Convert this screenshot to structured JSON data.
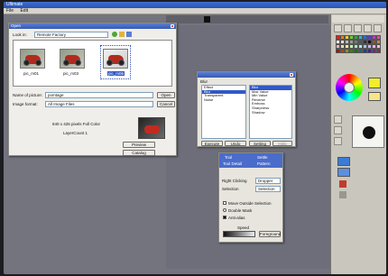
{
  "app": {
    "title": "Ultimate",
    "menu": [
      "File",
      "Edit"
    ]
  },
  "open_dialog": {
    "title": "Open",
    "look_in_label": "Look in:",
    "look_in_value": "Remote Factory",
    "thumbs": [
      {
        "label": "pic_m01"
      },
      {
        "label": "pic_m03"
      },
      {
        "label": "pic_m06",
        "selected": true
      }
    ],
    "name_label": "Name of picture:",
    "name_value": "pomtage",
    "type_label": "Image format:",
    "type_value": "All Image Files",
    "open_label": "Open",
    "cancel_label": "Cancel",
    "info_line": "640 x 426 pixels Full Color",
    "layer_line": "LayerCount 1",
    "preview_label": "Preview",
    "catalog_label": "Catalog"
  },
  "blur_dialog": {
    "title": "Blur",
    "left_items": [
      "Effect",
      "Blur",
      "Transparent",
      "Noise"
    ],
    "left_selected": 1,
    "right_items": [
      "Blur",
      "Max Value",
      "Min Value",
      "Reverse",
      "Emboss",
      "Sharpness",
      "Shadow"
    ],
    "right_selected": 0,
    "buttons": [
      "Execute",
      "Undo",
      "Setting",
      "Help"
    ]
  },
  "selection_panel": {
    "tabs": [
      "Tool",
      "Settle"
    ],
    "tabs2": [
      "Tool Detail",
      "Pattern"
    ],
    "right_clicking_label": "Right Clicking",
    "right_clicking_value": "Dropper",
    "selection_label": "Selection",
    "selection_value": "Selection",
    "options": [
      {
        "label": "Move Outside Selection",
        "checked": false
      },
      {
        "label": "Double Mask",
        "checked": false
      },
      {
        "label": "Anti-alias",
        "checked": true
      }
    ],
    "speed_label": "Speed",
    "apply_label": "Foreground"
  },
  "colors": {
    "palette": [
      "#e02020",
      "#f07a20",
      "#f4d21e",
      "#78c83c",
      "#2ea84a",
      "#2fb7c9",
      "#2d6de0",
      "#5b3cc4",
      "#b83cc4",
      "#e44a9a",
      "#ffffff",
      "#dddddd",
      "#bbbbbb",
      "#999999",
      "#777777",
      "#555555",
      "#333333",
      "#111111",
      "#8b5a2b",
      "#c08a4a",
      "#ffb0b0",
      "#ffd8a0",
      "#fff3a0",
      "#c8f0a0",
      "#a0f0c8",
      "#a0e8f8",
      "#a8c0ff",
      "#d0b0ff",
      "#f0b0f0",
      "#ffc0d8",
      "#901818",
      "#a04e10",
      "#a08a10",
      "#3c7a1e",
      "#1a6a2c",
      "#1a6a7a",
      "#1a3f8a",
      "#3a2480",
      "#742680",
      "#8a2a5a"
    ]
  }
}
